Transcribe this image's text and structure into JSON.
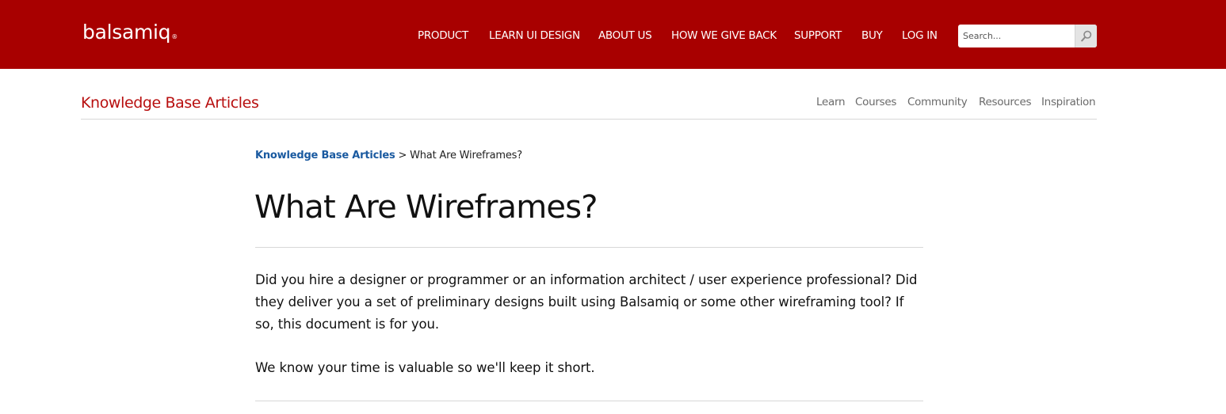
{
  "colors": {
    "header_bg": "#a80000",
    "header_text": "#ffffff",
    "kb_title": "#b80f0f",
    "breadcrumb_link": "#1a5aa0",
    "subnav_text": "#6a6a6a",
    "body_text": "#111111"
  },
  "header": {
    "logo_text": "balsamiq",
    "logo_mark": "®",
    "nav": [
      {
        "label": "PRODUCT"
      },
      {
        "label": "LEARN UI DESIGN"
      },
      {
        "label": "ABOUT US"
      },
      {
        "label": "HOW WE GIVE BACK"
      },
      {
        "label": "SUPPORT"
      },
      {
        "label": "BUY"
      },
      {
        "label": "LOG IN"
      }
    ],
    "search": {
      "placeholder": "Search...",
      "value": "",
      "icon": "search-icon"
    }
  },
  "section": {
    "title": "Knowledge Base Articles",
    "subnav": [
      {
        "label": "Learn"
      },
      {
        "label": "Courses"
      },
      {
        "label": "Community"
      },
      {
        "label": "Resources"
      },
      {
        "label": "Inspiration"
      }
    ]
  },
  "breadcrumb": {
    "parent": "Knowledge Base Articles",
    "separator": ">",
    "current": "What Are Wireframes?"
  },
  "article": {
    "title": "What Are Wireframes?",
    "paragraphs": [
      "Did you hire a designer or programmer or an information architect / user experience professional? Did they deliver you a set of preliminary designs built using Balsamiq or some other wireframing tool? If so, this document is for you.",
      "We know your time is valuable so we'll keep it short."
    ]
  }
}
